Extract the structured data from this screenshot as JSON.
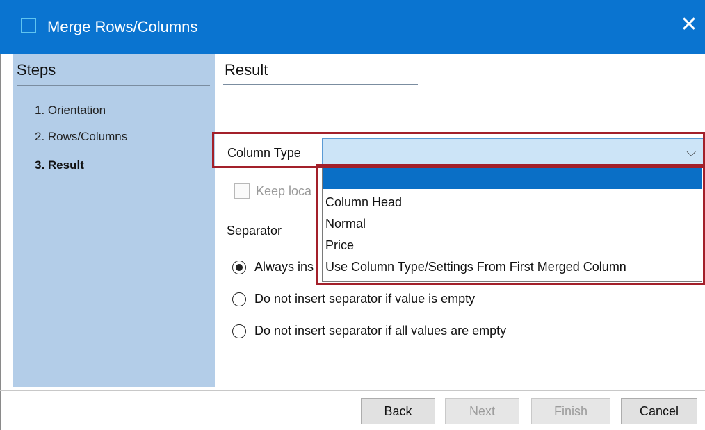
{
  "window": {
    "title": "Merge Rows/Columns",
    "close_glyph": "✕"
  },
  "sidebar": {
    "title": "Steps",
    "steps": [
      {
        "label": "1. Orientation",
        "active": false
      },
      {
        "label": "2. Rows/Columns",
        "active": false
      },
      {
        "label": "3. Result",
        "active": true
      }
    ]
  },
  "main": {
    "section_title": "Result",
    "column_type": {
      "label": "Column Type",
      "value": "",
      "chevron": "⌵",
      "options": [
        "",
        "Column Head",
        "Normal",
        "Price",
        "Use Column Type/Settings From First Merged Column"
      ],
      "highlighted_index": 0
    },
    "keep_local": {
      "label": "Keep loca",
      "checked": false,
      "enabled": false
    },
    "separator": {
      "label": "Separator",
      "options": [
        {
          "label": "Always ins",
          "checked": true
        },
        {
          "label": "Do not insert separator if value is empty",
          "checked": false
        },
        {
          "label": "Do not insert separator if all values are empty",
          "checked": false
        }
      ]
    }
  },
  "footer": {
    "back": "Back",
    "next": "Next",
    "finish": "Finish",
    "cancel": "Cancel"
  },
  "colors": {
    "titlebar": "#0a74d0",
    "sidebar": "#b3cde8",
    "highlight_box": "#a3202a",
    "dropdown_selected": "#0a6fc6",
    "select_bg": "#cce4f7"
  }
}
